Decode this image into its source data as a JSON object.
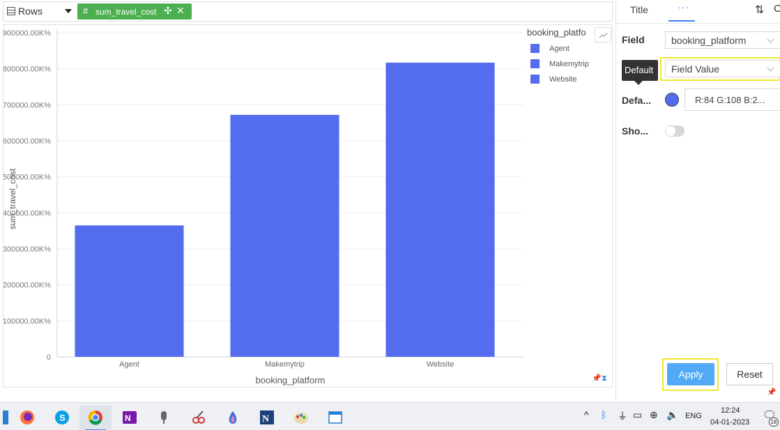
{
  "rows_bar": {
    "label": "Rows",
    "pill": {
      "hash": "#",
      "label": "sum_travel_cost",
      "move": "✣",
      "close": "✕"
    }
  },
  "chart_data": {
    "type": "bar",
    "categories": [
      "Agent",
      "Makemytrip",
      "Website"
    ],
    "values": [
      365000,
      672000,
      817000
    ],
    "xlabel": "booking_platform",
    "ylabel": "sum_travel_cost",
    "ylim": [
      0,
      900000
    ],
    "yticks": [
      "0",
      "100000.00K%",
      "200000.00K%",
      "300000.00K%",
      "400000.00K%",
      "500000.00K%",
      "600000.00K%",
      "700000.00K%",
      "800000.00K%",
      "900000.00K%"
    ],
    "series_color": "#546cee",
    "grid": true,
    "legend": {
      "title": "booking_platfo",
      "placement": "top-right",
      "entries": [
        "Agent",
        "Makemytrip",
        "Website"
      ]
    }
  },
  "right_panel": {
    "tab_title": "Title",
    "tab_more": "···",
    "sort_icon": "⇅",
    "cut_icon": "C",
    "field_label": "Field",
    "field_value": "booking_platform",
    "default_tooltip": "Default",
    "default_value": "Field Value",
    "default_color_label": "Defa...",
    "default_color_value": "R:84 G:108 B:2...",
    "default_color_hex": "#546cee",
    "show_label": "Sho...",
    "apply": "Apply",
    "reset": "Reset",
    "highlight_color": "#f0e82a"
  },
  "taskbar": {
    "tray_chevron": "^",
    "lang": "ENG",
    "time": "12:24",
    "date": "04-01-2023",
    "notifications": "18"
  }
}
